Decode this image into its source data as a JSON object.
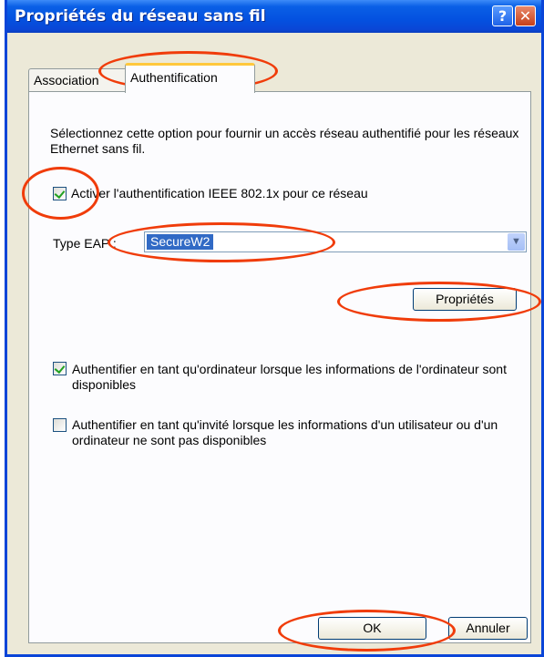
{
  "window": {
    "title": "Propriétés du réseau sans fil",
    "help_glyph": "?",
    "close_glyph": "✕"
  },
  "tabs": [
    {
      "label": "Association"
    },
    {
      "label": "Authentification"
    }
  ],
  "panel": {
    "description": "Sélectionnez cette option pour fournir un accès réseau authentifié pour les réseaux Ethernet sans fil.",
    "enable_8021x": {
      "label": "Activer l'authentification IEEE 802.1x pour ce réseau",
      "checked": true
    },
    "eap_type": {
      "label": "Type EAP :",
      "value": "SecureW2"
    },
    "properties_button": "Propriétés",
    "auth_computer": {
      "label": "Authentifier en tant qu'ordinateur lorsque les informations de l'ordinateur sont disponibles",
      "checked": true
    },
    "auth_guest": {
      "label": "Authentifier en tant qu'invité lorsque les informations d'un utilisateur ou d'un ordinateur ne sont pas disponibles",
      "checked": false
    }
  },
  "footer": {
    "ok_label": "OK",
    "cancel_label": "Annuler"
  },
  "colors": {
    "title_bar": "#0451e0",
    "annotation": "#f03c0a",
    "checkmark": "#21a121",
    "selection": "#316ac5"
  }
}
